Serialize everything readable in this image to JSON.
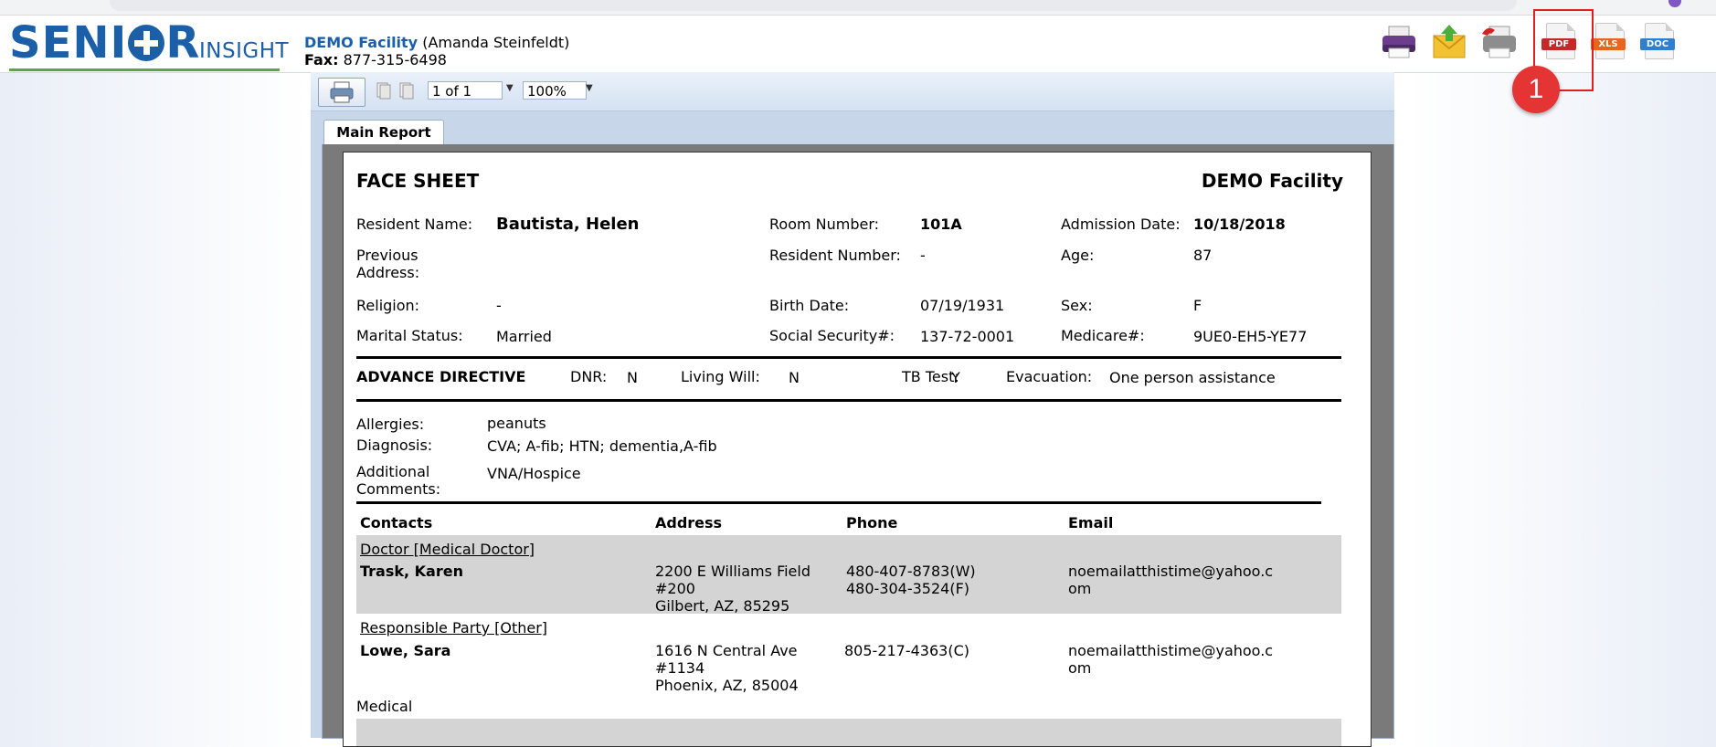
{
  "header": {
    "logo_main": "SENI",
    "logo_main_end": "R",
    "logo_sub": "INSIGHT",
    "facility_name": "DEMO Facility",
    "facility_user": "(Amanda Steinfeldt)",
    "fax_label": "Fax:",
    "fax_value": "877-315-6498",
    "export_icons": [
      "print-icon",
      "email-icon",
      "fax-print-icon",
      "pdf-icon",
      "xls-icon",
      "doc-icon"
    ],
    "pdf_label": "PDF",
    "xls_label": "XLS",
    "doc_label": "DOC",
    "annotation_marker": "1"
  },
  "viewer": {
    "page_display": "1 of 1",
    "zoom": "100%",
    "tab_label": "Main Report"
  },
  "report": {
    "title": "FACE SHEET",
    "facility": "DEMO Facility",
    "resident_name_label": "Resident Name:",
    "resident_name": "Bautista, Helen",
    "room_number_label": "Room Number:",
    "room_number": "101A",
    "admission_date_label": "Admission Date:",
    "admission_date": "10/18/2018",
    "previous_address_label_1": "Previous",
    "previous_address_label_2": "Address:",
    "resident_number_label": "Resident Number:",
    "resident_number": "-",
    "age_label": "Age:",
    "age": "87",
    "religion_label": "Religion:",
    "religion": "-",
    "birth_date_label": "Birth Date:",
    "birth_date": "07/19/1931",
    "sex_label": "Sex:",
    "sex": "F",
    "marital_status_label": "Marital Status:",
    "marital_status": "Married",
    "ssn_label": "Social Security#:",
    "ssn": "137-72-0001",
    "medicare_label": "Medicare#:",
    "medicare": "9UE0-EH5-YE77",
    "advance_directive": {
      "title": "ADVANCE DIRECTIVE",
      "dnr_label": "DNR:",
      "dnr": "N",
      "living_will_label": "Living Will:",
      "living_will": "N",
      "tb_test_label": "TB Test:",
      "tb_test": "Y",
      "evacuation_label": "Evacuation:",
      "evacuation": "One person assistance"
    },
    "allergies_label": "Allergies:",
    "allergies": "peanuts",
    "diagnosis_label": "Diagnosis:",
    "diagnosis": "CVA; A-fib; HTN; dementia,A-fib",
    "comments_label_1": "Additional",
    "comments_label_2": "Comments:",
    "comments": "VNA/Hospice",
    "contacts_headers": [
      "Contacts",
      "Address",
      "Phone",
      "Email"
    ],
    "contacts": [
      {
        "role": "Doctor [Medical Doctor]",
        "name": "Trask, Karen",
        "address": [
          "2200 E Williams Field",
          "#200",
          "Gilbert, AZ, 85295"
        ],
        "phone": [
          "480-407-8783(W)",
          "480-304-3524(F)"
        ],
        "email": [
          "noemailatthistime@yahoo.c",
          "om"
        ]
      },
      {
        "role": "Responsible Party [Other]",
        "name": "Lowe, Sara",
        "address": [
          "1616 N Central Ave",
          "#1134",
          "Phoenix, AZ, 85004"
        ],
        "phone": [
          "805-217-4363(C)"
        ],
        "email": [
          "noemailatthistime@yahoo.c",
          "om"
        ]
      }
    ],
    "section_medical": "Medical"
  }
}
